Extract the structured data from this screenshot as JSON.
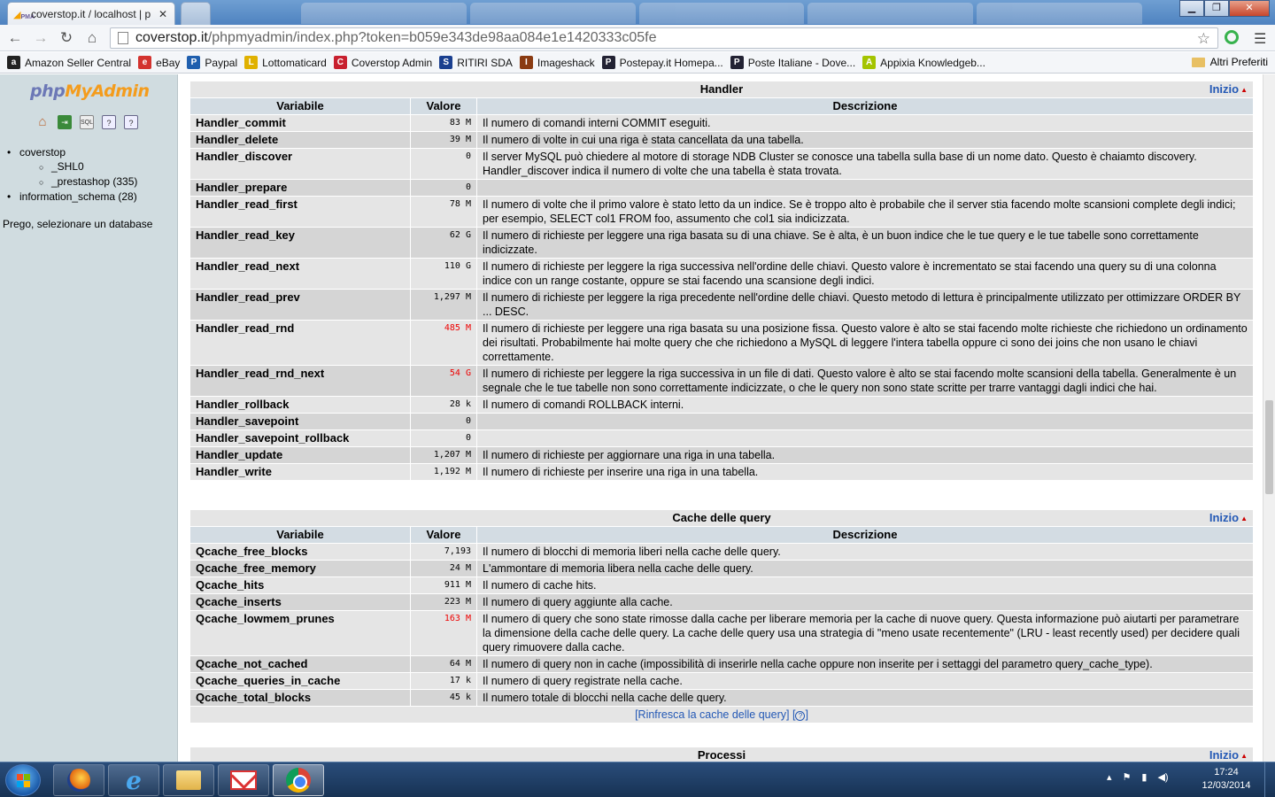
{
  "browser": {
    "tab_title": "coverstop.it / localhost | p",
    "tab_favicon": "PMA",
    "url_host": "coverstop.it",
    "url_path": "/phpmyadmin/index.php?token=b059e343de98aa084e1e1420333c05fe",
    "bookmarks": [
      {
        "label": "Amazon Seller Central",
        "icon": "a",
        "color": "#222222"
      },
      {
        "label": "eBay",
        "icon": "e",
        "color": "#d3332f"
      },
      {
        "label": "Paypal",
        "icon": "P",
        "color": "#1f5fae"
      },
      {
        "label": "Lottomaticard",
        "icon": "L",
        "color": "#e0b100"
      },
      {
        "label": "Coverstop Admin",
        "icon": "C",
        "color": "#c8202f"
      },
      {
        "label": "RITIRI SDA",
        "icon": "S",
        "color": "#1a3f8f"
      },
      {
        "label": "Imageshack",
        "icon": "I",
        "color": "#8a3b12"
      },
      {
        "label": "Postepay.it Homepa...",
        "icon": "P",
        "color": "#223"
      },
      {
        "label": "Poste Italiane - Dove...",
        "icon": "P",
        "color": "#223"
      },
      {
        "label": "Appixia Knowledgeb...",
        "icon": "A",
        "color": "#a4c400"
      }
    ],
    "bookmarks_other": "Altri Preferiti"
  },
  "nav": {
    "logo_php": "php",
    "logo_myadmin": "MyAdmin",
    "tree": [
      {
        "label": "coverstop",
        "children": [
          "_SHL0",
          "_prestashop (335)"
        ]
      },
      {
        "label": "information_schema (28)",
        "children": []
      }
    ],
    "message": "Prego, selezionare un database"
  },
  "handler": {
    "caption": "Handler",
    "inizio": "Inizio",
    "headers": {
      "var": "Variabile",
      "val": "Valore",
      "desc": "Descrizione"
    },
    "rows": [
      {
        "name": "Handler_commit",
        "value": "83 M",
        "alert": false,
        "desc": "Il numero di comandi interni COMMIT eseguiti."
      },
      {
        "name": "Handler_delete",
        "value": "39 M",
        "alert": false,
        "desc": "Il numero di volte in cui una riga è stata cancellata da una tabella."
      },
      {
        "name": "Handler_discover",
        "value": "0",
        "alert": false,
        "desc": "Il server MySQL può chiedere al motore di storage NDB Cluster se conosce una tabella sulla base di un nome dato. Questo è chaiamto discovery. Handler_discover indica il numero di volte che una tabella è stata trovata."
      },
      {
        "name": "Handler_prepare",
        "value": "0",
        "alert": false,
        "desc": ""
      },
      {
        "name": "Handler_read_first",
        "value": "78 M",
        "alert": false,
        "desc": "Il numero di volte che il primo valore è stato letto da un indice. Se è troppo alto è probabile che il server stia facendo molte scansioni complete degli indici; per esempio, SELECT col1 FROM foo, assumento che col1 sia indicizzata."
      },
      {
        "name": "Handler_read_key",
        "value": "62 G",
        "alert": false,
        "desc": "Il numero di richieste per leggere una riga basata su di una chiave. Se è alta, è un buon indice che le tue query e le tue tabelle sono correttamente indicizzate."
      },
      {
        "name": "Handler_read_next",
        "value": "110 G",
        "alert": false,
        "desc": "Il numero di richieste per leggere la riga successiva nell'ordine delle chiavi. Questo valore è incrementato se stai facendo una query su di una colonna indice con un range costante, oppure se stai facendo una scansione degli indici."
      },
      {
        "name": "Handler_read_prev",
        "value": "1,297 M",
        "alert": false,
        "desc": "Il numero di richieste per leggere la riga precedente nell'ordine delle chiavi. Questo metodo di lettura è principalmente utilizzato per ottimizzare ORDER BY ... DESC."
      },
      {
        "name": "Handler_read_rnd",
        "value": "485 M",
        "alert": true,
        "desc": "Il numero di richieste per leggere una riga basata su una posizione fissa. Questo valore è alto se stai facendo molte richieste che richiedono un ordinamento dei risultati. Probabilmente hai molte query che che richiedono a MySQL di leggere l'intera tabella oppure ci sono dei joins che non usano le chiavi correttamente."
      },
      {
        "name": "Handler_read_rnd_next",
        "value": "54 G",
        "alert": true,
        "desc": "Il numero di richieste per leggere la riga successiva in un file di dati. Questo valore è alto se stai facendo molte scansioni della tabella. Generalmente è un segnale che le tue tabelle non sono correttamente indicizzate, o che le query non sono state scritte per trarre vantaggi dagli indici che hai."
      },
      {
        "name": "Handler_rollback",
        "value": "28 k",
        "alert": false,
        "desc": "Il numero di comandi ROLLBACK interni."
      },
      {
        "name": "Handler_savepoint",
        "value": "0",
        "alert": false,
        "desc": ""
      },
      {
        "name": "Handler_savepoint_rollback",
        "value": "0",
        "alert": false,
        "desc": ""
      },
      {
        "name": "Handler_update",
        "value": "1,207 M",
        "alert": false,
        "desc": "Il numero di richieste per aggiornare una riga in una tabella."
      },
      {
        "name": "Handler_write",
        "value": "1,192 M",
        "alert": false,
        "desc": "Il numero di richieste per inserire una riga in una tabella."
      }
    ]
  },
  "qcache": {
    "caption": "Cache delle query",
    "inizio": "Inizio",
    "headers": {
      "var": "Variabile",
      "val": "Valore",
      "desc": "Descrizione"
    },
    "rows": [
      {
        "name": "Qcache_free_blocks",
        "value": "7,193",
        "alert": false,
        "desc": "Il numero di blocchi di memoria liberi nella cache delle query."
      },
      {
        "name": "Qcache_free_memory",
        "value": "24 M",
        "alert": false,
        "desc": "L'ammontare di memoria libera nella cache delle query."
      },
      {
        "name": "Qcache_hits",
        "value": "911 M",
        "alert": false,
        "desc": "Il numero di cache hits."
      },
      {
        "name": "Qcache_inserts",
        "value": "223 M",
        "alert": false,
        "desc": "Il numero di query aggiunte alla cache."
      },
      {
        "name": "Qcache_lowmem_prunes",
        "value": "163 M",
        "alert": true,
        "desc": "Il numero di query che sono state rimosse dalla cache per liberare memoria per la cache di nuove query. Questa informazione può aiutarti per parametrare la dimensione della cache delle query. La cache delle query usa una strategia di \"meno usate recentemente\" (LRU - least recently used) per decidere quali query rimuovere dalla cache."
      },
      {
        "name": "Qcache_not_cached",
        "value": "64 M",
        "alert": false,
        "desc": "Il numero di query non in cache (impossibilità di inserirle nella cache oppure non inserite per i settaggi del parametro query_cache_type)."
      },
      {
        "name": "Qcache_queries_in_cache",
        "value": "17 k",
        "alert": false,
        "desc": "Il numero di query registrate nella cache."
      },
      {
        "name": "Qcache_total_blocks",
        "value": "45 k",
        "alert": false,
        "desc": "Il numero totale di blocchi nella cache delle query."
      }
    ],
    "refresh_link": "[Rinfresca la cache delle query]",
    "help_open": "[",
    "help_glyph": "?",
    "help_close": "]"
  },
  "processi": {
    "caption": "Processi",
    "inizio": "Inizio"
  },
  "taskbar": {
    "time": "17:24",
    "date": "12/03/2014"
  }
}
